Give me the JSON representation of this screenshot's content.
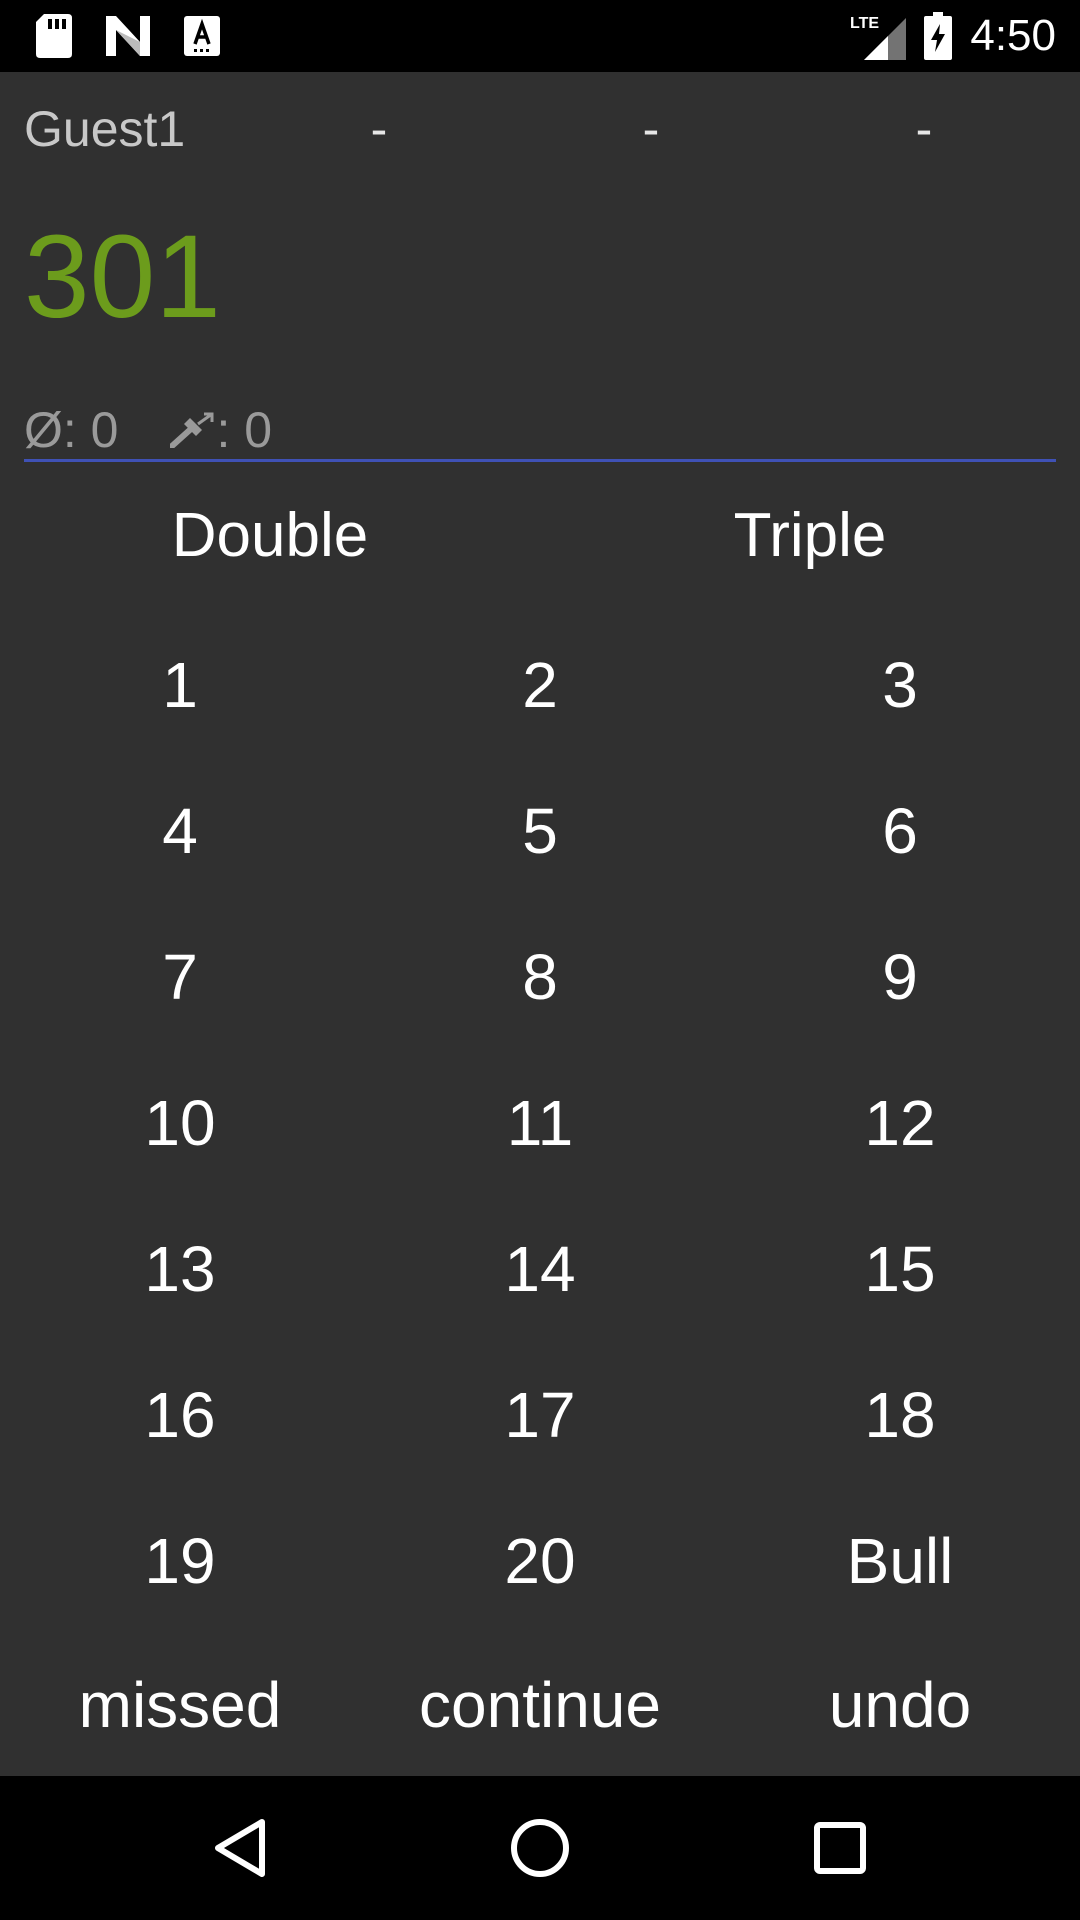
{
  "status_bar": {
    "icons_left": [
      "sd-card-icon",
      "n-logo-icon",
      "keyboard-a-icon"
    ],
    "network": "LTE",
    "time": "4:50"
  },
  "player": {
    "name": "Guest1",
    "darts": [
      "-",
      "-",
      "-"
    ],
    "score": "301",
    "average_label": "Ø: 0",
    "darts_count_label": ": 0"
  },
  "modifiers": {
    "double": "Double",
    "triple": "Triple"
  },
  "keypad": {
    "rows": [
      [
        "1",
        "2",
        "3"
      ],
      [
        "4",
        "5",
        "6"
      ],
      [
        "7",
        "8",
        "9"
      ],
      [
        "10",
        "11",
        "12"
      ],
      [
        "13",
        "14",
        "15"
      ],
      [
        "16",
        "17",
        "18"
      ],
      [
        "19",
        "20",
        "Bull"
      ]
    ]
  },
  "actions": {
    "missed": "missed",
    "continue": "continue",
    "undo": "undo"
  },
  "colors": {
    "background": "#303030",
    "score": "#6c9c1c",
    "accent_line": "#3f51b5"
  }
}
